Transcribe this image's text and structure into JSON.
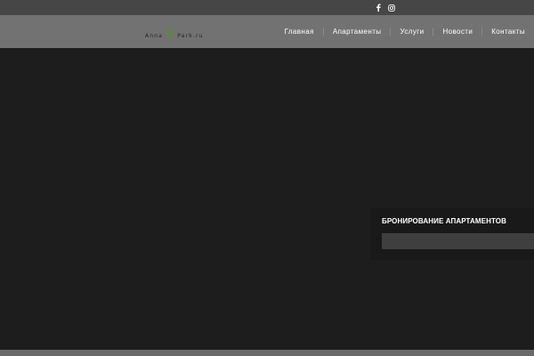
{
  "topbar": {
    "social": [
      {
        "name": "facebook-icon",
        "glyph": "f"
      },
      {
        "name": "instagram-icon",
        "glyph": ""
      }
    ]
  },
  "logo": {
    "left_word": "Anna",
    "right_word": "Park.ru"
  },
  "nav": {
    "items": [
      {
        "label": "Главная"
      },
      {
        "label": "Апартаменты"
      },
      {
        "label": "Услуги"
      },
      {
        "label": "Новости"
      },
      {
        "label": "Контакты"
      }
    ]
  },
  "booking": {
    "title": "БРОНИРОВАНИЕ АПАРТАМЕНТОВ",
    "field_value": ""
  },
  "colors": {
    "topbar": "#464646",
    "navbar": "#727272",
    "hero": "#1d1d1d",
    "booking_panel": "#191919",
    "booking_field": "#3f3f3f",
    "logo_tree": "#5c8a3a"
  }
}
